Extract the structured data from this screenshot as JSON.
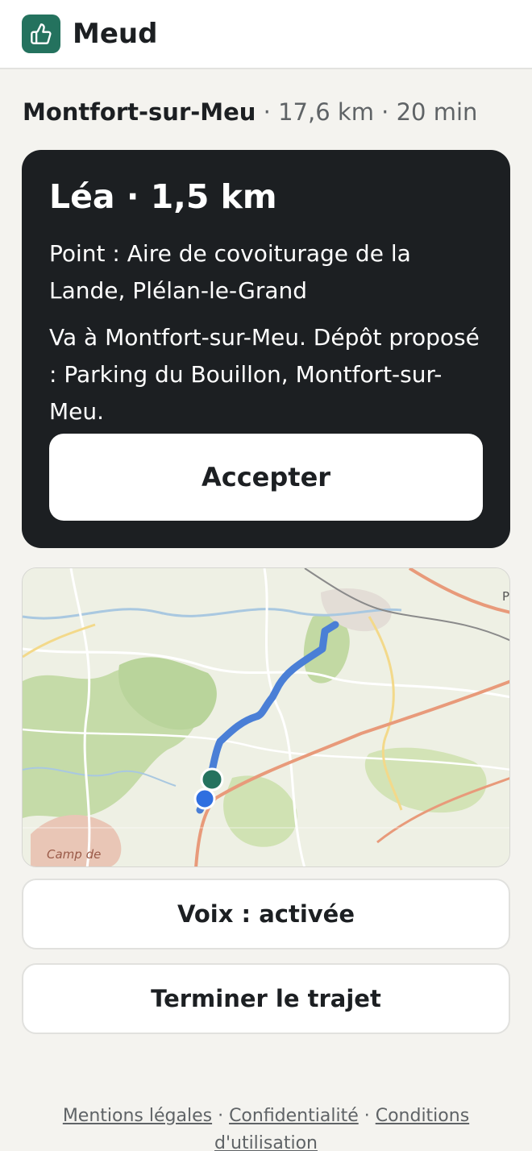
{
  "header": {
    "brand": "Meud",
    "logo_icon": "thumbs-up-icon",
    "accent": "#24725e"
  },
  "route": {
    "destination": "Montfort-sur-Meu",
    "meta": " · 17,6 km · 20 min"
  },
  "offer": {
    "title": "Léa · 1,5 km",
    "point": "Point : Aire de covoiturage de la Lande, Plélan-le-Grand",
    "destination_text": "Va à Montfort-sur-Meu. Dépôt proposé : Parking du Bouillon, Montfort-sur-Meu.",
    "accept_label": "Accepter"
  },
  "map": {
    "label_camp": "Camp de",
    "label_edge": "P",
    "route_color": "#4a7fd6",
    "pickup_color": "#24725e",
    "position_color": "#2f6fe0"
  },
  "actions": {
    "voice_label": "Voix : activée",
    "end_label": "Terminer le trajet"
  },
  "footer": {
    "legal": "Mentions légales",
    "sep1": " · ",
    "privacy": "Confidentialité",
    "sep2": " · ",
    "terms": "Conditions d'utilisation"
  }
}
